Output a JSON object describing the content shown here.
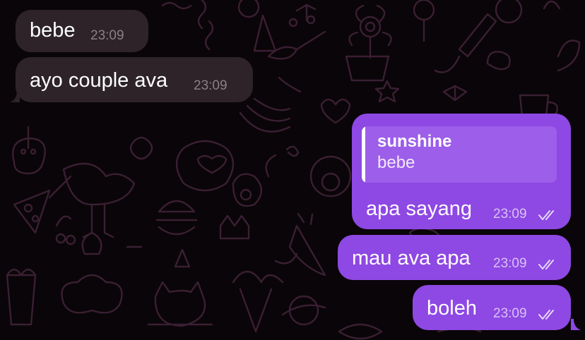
{
  "colors": {
    "background": "#0a0508",
    "doodle": "#3a1f33",
    "incoming_bubble": "#2d2329",
    "outgoing_bubble": "#8e48e3",
    "reply_box": "#9d5eea",
    "incoming_time": "#8c7f87",
    "outgoing_time": "#d8c3f5"
  },
  "messages": [
    {
      "direction": "incoming",
      "text": "bebe",
      "time": "23:09"
    },
    {
      "direction": "incoming",
      "text": "ayo couple ava",
      "time": "23:09"
    },
    {
      "direction": "outgoing",
      "reply": {
        "name": "sunshine",
        "text": "bebe"
      },
      "text": "apa sayang",
      "time": "23:09",
      "status_icon": "double-check-icon"
    },
    {
      "direction": "outgoing",
      "text": "mau ava apa",
      "time": "23:09",
      "status_icon": "double-check-icon"
    },
    {
      "direction": "outgoing",
      "text": "boleh",
      "time": "23:09",
      "status_icon": "double-check-icon"
    }
  ]
}
